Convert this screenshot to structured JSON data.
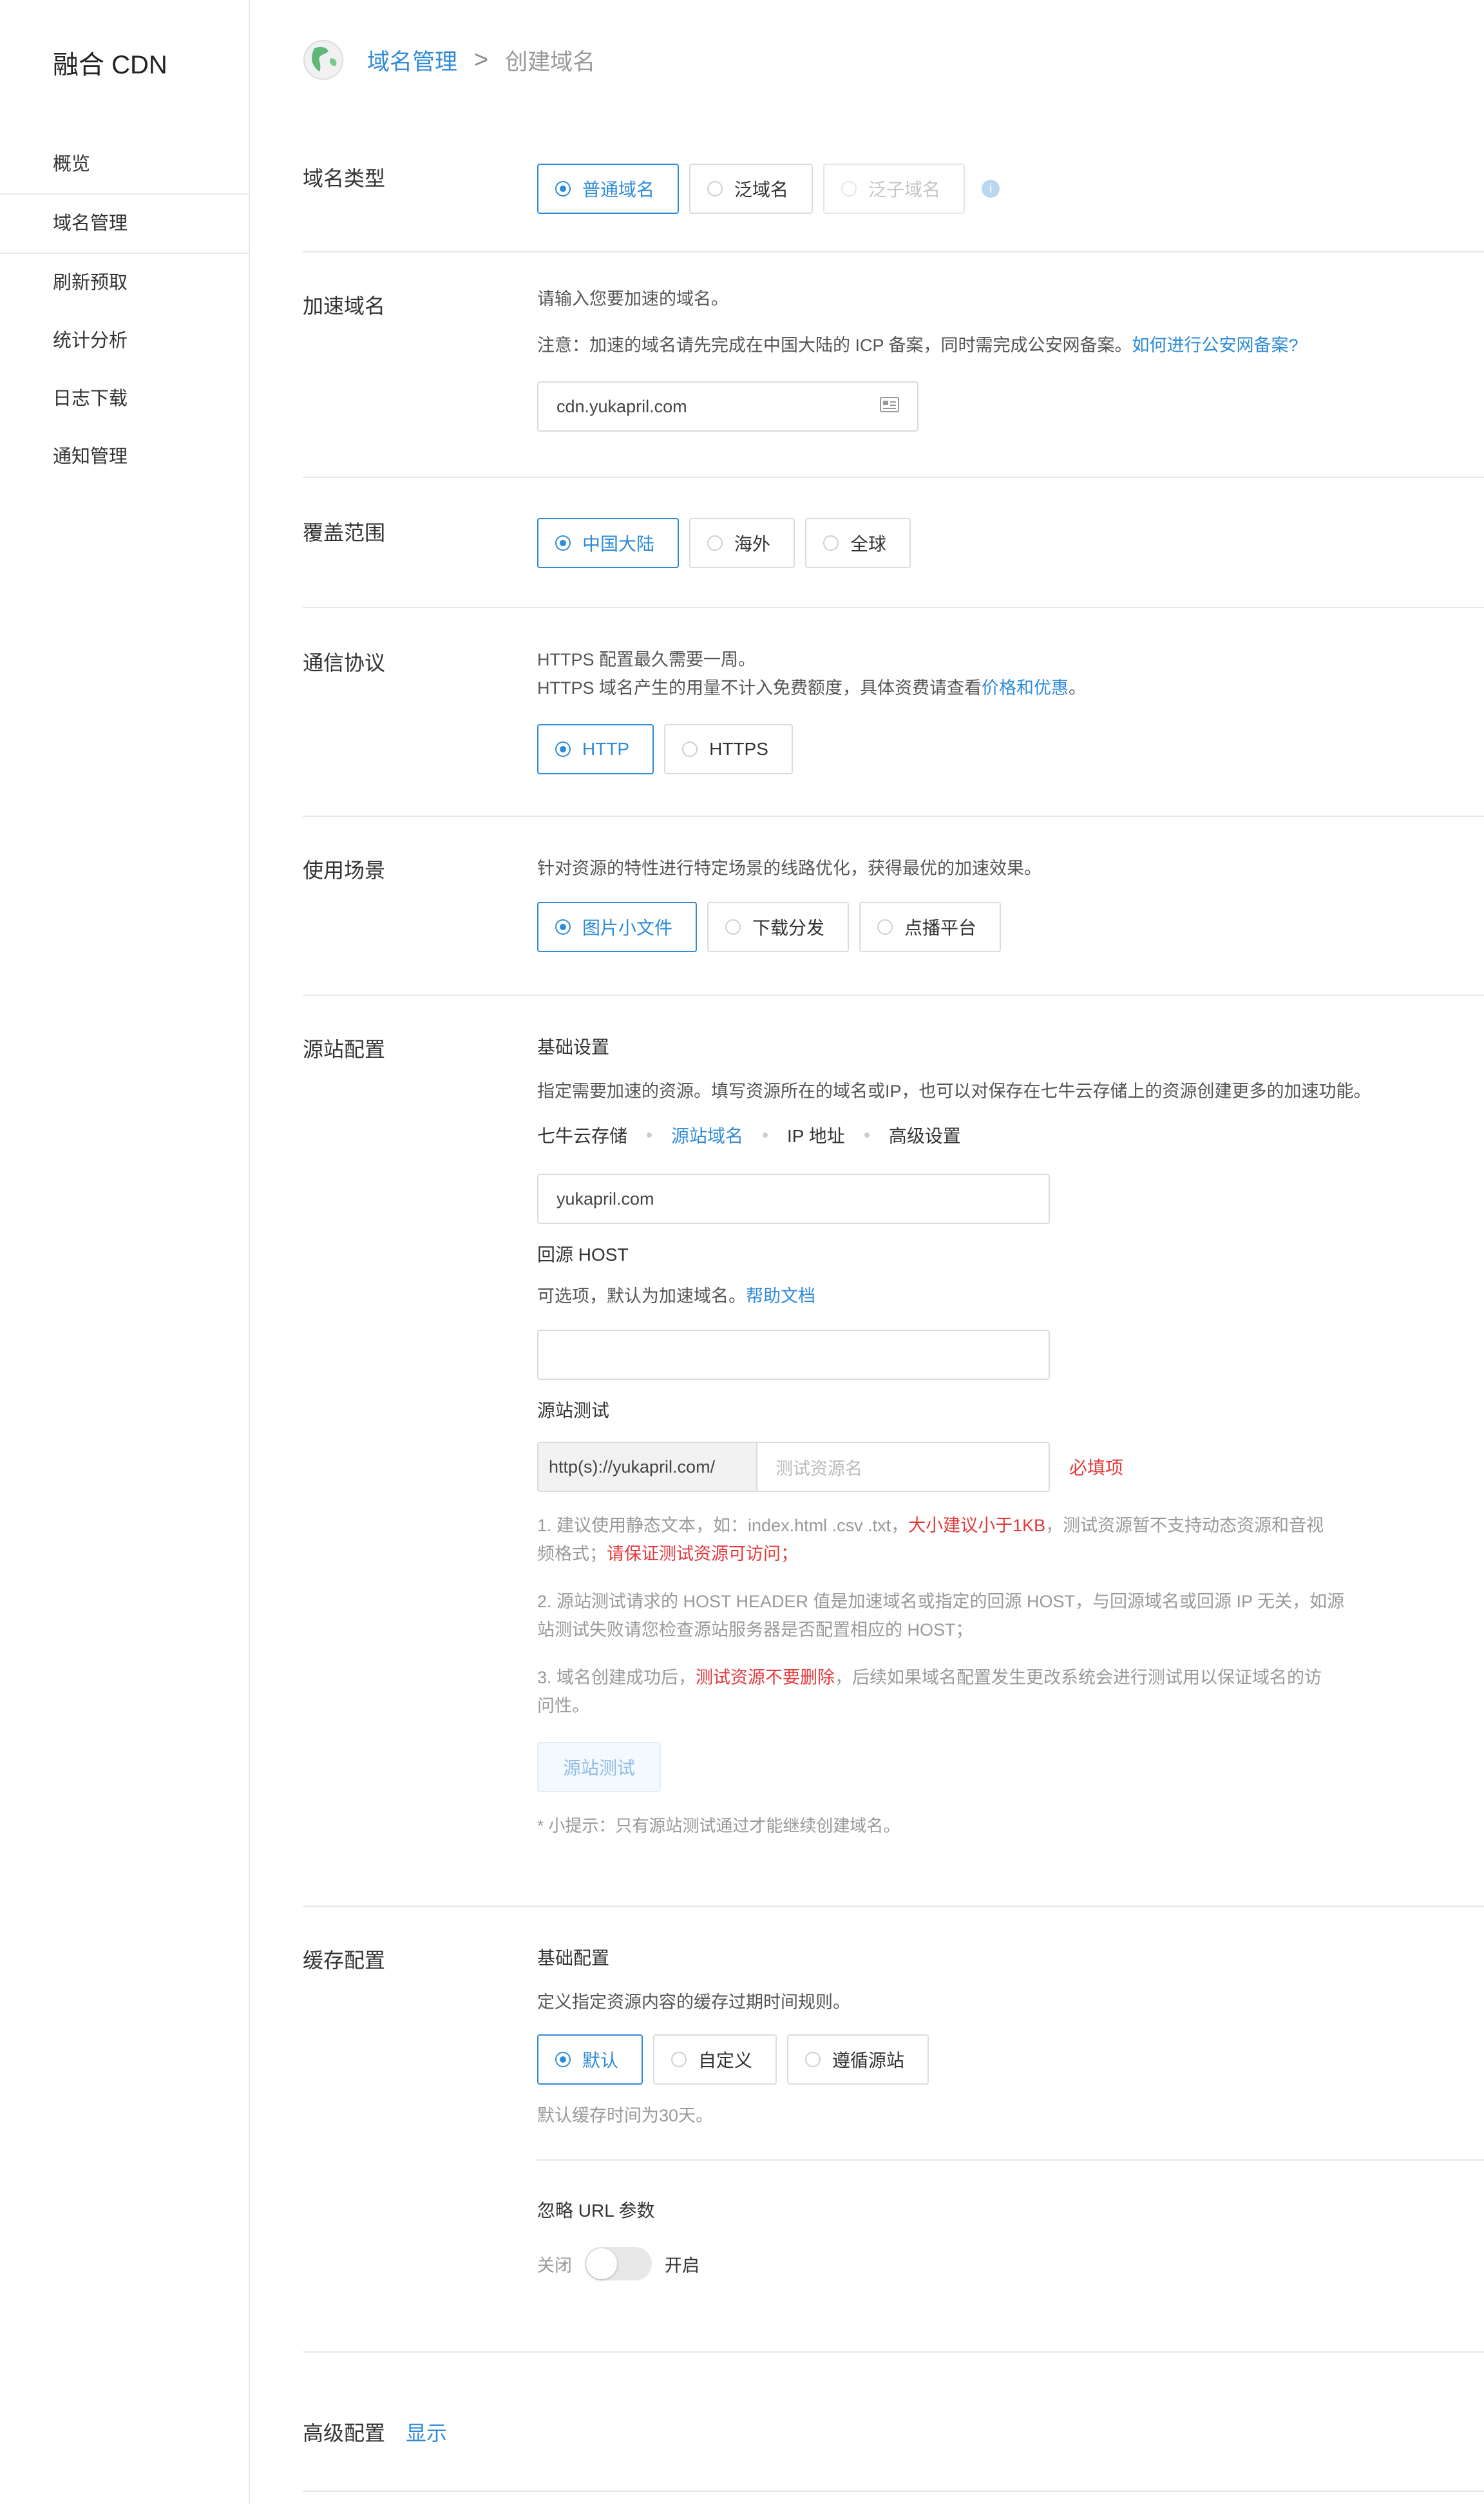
{
  "sidebar": {
    "brand": "融合 CDN",
    "items": [
      "概览",
      "域名管理",
      "刷新预取",
      "统计分析",
      "日志下载",
      "通知管理"
    ]
  },
  "breadcrumb": {
    "parent": "域名管理",
    "separator": ">",
    "current": "创建域名"
  },
  "domain_type": {
    "title": "域名类型",
    "options": [
      "普通域名",
      "泛域名",
      "泛子域名"
    ],
    "info_icon": "info-icon"
  },
  "accel_domain": {
    "title": "加速域名",
    "hint": "请输入您要加速的域名。",
    "note": "注意：加速的域名请先完成在中国大陆的 ICP 备案，同时需完成公安网备案。",
    "note_link": "如何进行公安网备案?",
    "value": "cdn.yukapril.com",
    "input_icon": "id-card-icon"
  },
  "coverage": {
    "title": "覆盖范围",
    "options": [
      "中国大陆",
      "海外",
      "全球"
    ]
  },
  "protocol": {
    "title": "通信协议",
    "line1": "HTTPS 配置最久需要一周。",
    "line2_pre": "HTTPS 域名产生的用量不计入免费额度，具体资费请查看",
    "line2_link": "价格和优惠",
    "line2_post": "。",
    "options": [
      "HTTP",
      "HTTPS"
    ]
  },
  "scenario": {
    "title": "使用场景",
    "desc": "针对资源的特性进行特定场景的线路优化，获得最优的加速效果。",
    "options": [
      "图片小文件",
      "下载分发",
      "点播平台"
    ]
  },
  "origin": {
    "title": "源站配置",
    "basic_label": "基础设置",
    "desc": "指定需要加速的资源。填写资源所在的域名或IP，也可以对保存在七牛云存储上的资源创建更多的加速功能。",
    "tabs": [
      "七牛云存储",
      "源站域名",
      "IP 地址",
      "高级设置"
    ],
    "origin_value": "yukapril.com",
    "host_label": "回源 HOST",
    "host_desc": "可选项，默认为加速域名。",
    "host_link": "帮助文档",
    "test_label": "源站测试",
    "test_prefix": "http(s)://yukapril.com/",
    "test_placeholder": "测试资源名",
    "required": "必填项",
    "note1_a": "1. 建议使用静态文本，如：index.html .csv .txt，",
    "note1_red": "大小建议小于1KB",
    "note1_b": "，测试资源暂不支持动态资源和音视",
    "note1_c": "频格式；",
    "note1_red2": "请保证测试资源可访问；",
    "note2_a": "2. 源站测试请求的 HOST HEADER 值是加速域名或指定的回源 HOST，与回源域名或回源 IP 无关，如源",
    "note2_b": "站测试失败请您检查源站服务器是否配置相应的 HOST；",
    "note3_a": "3. 域名创建成功后，",
    "note3_red": "测试资源不要删除",
    "note3_b": "，后续如果域名配置发生更改系统会进行测试用以保证域名的访",
    "note3_c": "问性。",
    "test_button": "源站测试",
    "tip": "* 小提示：只有源站测试通过才能继续创建域名。"
  },
  "cache": {
    "title": "缓存配置",
    "basic_label": "基础配置",
    "desc": "定义指定资源内容的缓存过期时间规则。",
    "options": [
      "默认",
      "自定义",
      "遵循源站"
    ],
    "default_note": "默认缓存时间为30天。",
    "ignore_label": "忽略 URL 参数",
    "off_label": "关闭",
    "on_label": "开启"
  },
  "advanced": {
    "title": "高级配置",
    "toggle_link": "显示"
  },
  "colors": {
    "accent": "#2f8bd8",
    "danger": "#e4393c",
    "border": "#dcdcdc"
  }
}
